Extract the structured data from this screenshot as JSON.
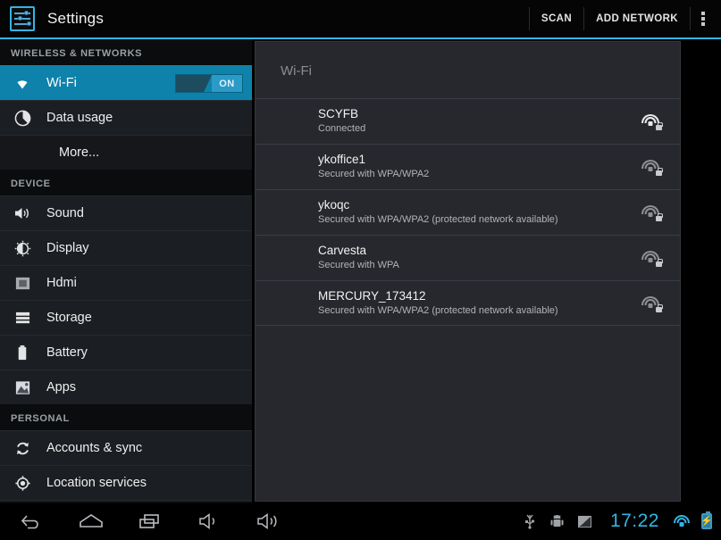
{
  "actionbar": {
    "app_icon": "settings-sliders-icon",
    "title": "Settings",
    "scan_label": "SCAN",
    "add_network_label": "ADD NETWORK",
    "overflow_label": "overflow-menu",
    "accent_color": "#33b5e5"
  },
  "sidebar": {
    "sections": [
      {
        "header": "WIRELESS & NETWORKS",
        "items": [
          {
            "label": "Wi-Fi",
            "icon": "wifi-icon",
            "selected": true,
            "toggle": "ON"
          },
          {
            "label": "Data usage",
            "icon": "pie-chart-icon",
            "selected": false
          },
          {
            "label": "More...",
            "icon": "none",
            "selected": false,
            "indent": true
          }
        ]
      },
      {
        "header": "DEVICE",
        "items": [
          {
            "label": "Sound",
            "icon": "speaker-icon",
            "selected": false
          },
          {
            "label": "Display",
            "icon": "brightness-icon",
            "selected": false
          },
          {
            "label": "Hdmi",
            "icon": "screen-icon",
            "selected": false
          },
          {
            "label": "Storage",
            "icon": "storage-icon",
            "selected": false
          },
          {
            "label": "Battery",
            "icon": "battery-icon",
            "selected": false
          },
          {
            "label": "Apps",
            "icon": "apps-icon",
            "selected": false
          }
        ]
      },
      {
        "header": "PERSONAL",
        "items": [
          {
            "label": "Accounts & sync",
            "icon": "sync-icon",
            "selected": false
          },
          {
            "label": "Location services",
            "icon": "location-crosshair-icon",
            "selected": false
          }
        ]
      }
    ],
    "selected_color": "#0e82ab"
  },
  "content": {
    "heading": "Wi-Fi",
    "networks": [
      {
        "ssid": "SCYFB",
        "status": "Connected",
        "connected": true,
        "secured": true
      },
      {
        "ssid": "ykoffice1",
        "status": "Secured with WPA/WPA2",
        "connected": false,
        "secured": true
      },
      {
        "ssid": "ykoqc",
        "status": "Secured with WPA/WPA2 (protected network available)",
        "connected": false,
        "secured": true
      },
      {
        "ssid": "Carvesta",
        "status": "Secured with WPA",
        "connected": false,
        "secured": true
      },
      {
        "ssid": "MERCURY_173412",
        "status": "Secured with WPA/WPA2 (protected network available)",
        "connected": false,
        "secured": true
      }
    ]
  },
  "navbar": {
    "buttons": [
      {
        "name": "back-icon"
      },
      {
        "name": "home-icon"
      },
      {
        "name": "recents-icon"
      },
      {
        "name": "volume-down-icon"
      },
      {
        "name": "volume-up-icon"
      }
    ],
    "status_icons": [
      {
        "name": "usb-icon"
      },
      {
        "name": "android-debug-icon"
      },
      {
        "name": "screenshot-icon"
      }
    ],
    "clock": "17:22",
    "wifi": "wifi-status-icon",
    "battery": "battery-charging-icon",
    "clock_color": "#33b5e5"
  }
}
